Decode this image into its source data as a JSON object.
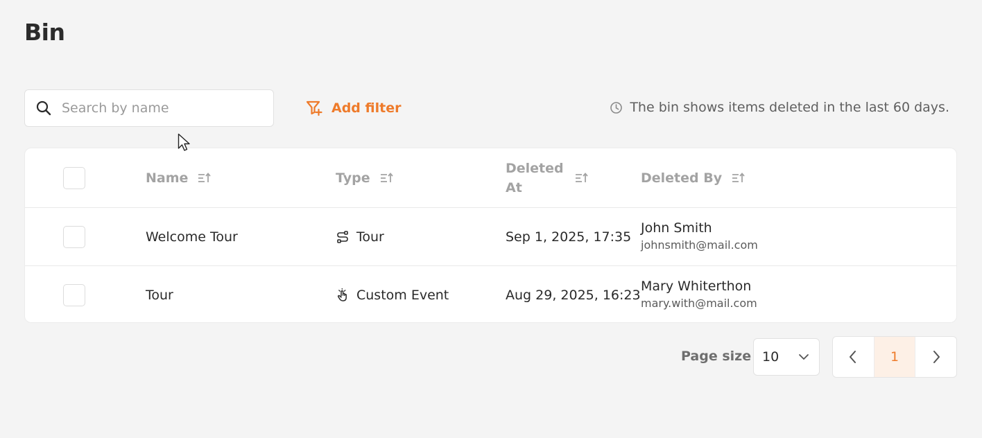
{
  "page": {
    "title": "Bin"
  },
  "search": {
    "placeholder": "Search by name",
    "value": ""
  },
  "filter": {
    "add_label": "Add filter"
  },
  "info": {
    "bin_note": "The bin shows items deleted in the last 60 days."
  },
  "table": {
    "columns": [
      {
        "label": "Name"
      },
      {
        "label": "Type"
      },
      {
        "label": "Deleted At"
      },
      {
        "label": "Deleted By"
      }
    ],
    "rows": [
      {
        "name": "Welcome Tour",
        "type": "Tour",
        "type_icon": "tour-icon",
        "deleted_at": "Sep 1, 2025, 17:35",
        "deleted_by_name": "John Smith",
        "deleted_by_email": "johnsmith@mail.com"
      },
      {
        "name": "Tour",
        "type": "Custom Event",
        "type_icon": "hand-tap-icon",
        "deleted_at": "Aug 29, 2025, 16:23",
        "deleted_by_name": "Mary Whiterthon",
        "deleted_by_email": "mary.with@mail.com"
      }
    ]
  },
  "pagination": {
    "page_size_label": "Page size",
    "page_size_value": "10",
    "current_page": "1"
  },
  "colors": {
    "accent": "#ee7b2b",
    "current_page_bg": "#fdf0e6"
  }
}
